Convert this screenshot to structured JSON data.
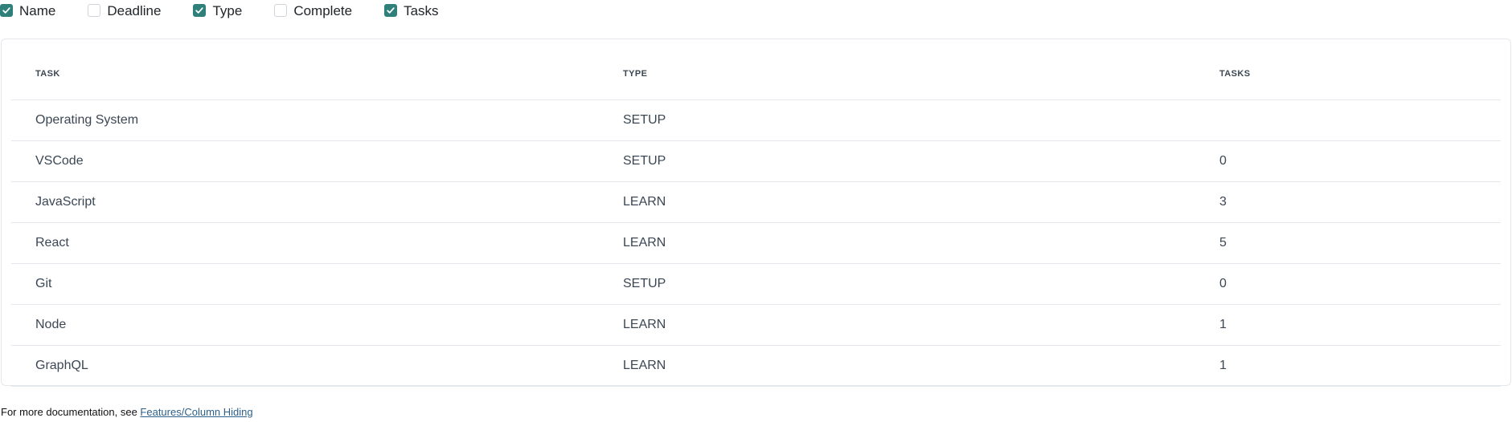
{
  "toggles": [
    {
      "label": "Name",
      "checked": true
    },
    {
      "label": "Deadline",
      "checked": false
    },
    {
      "label": "Type",
      "checked": true
    },
    {
      "label": "Complete",
      "checked": false
    },
    {
      "label": "Tasks",
      "checked": true
    }
  ],
  "table": {
    "headers": {
      "task": "TASK",
      "type": "TYPE",
      "tasks": "TASKS"
    },
    "rows": [
      {
        "task": "Operating System",
        "type": "SETUP",
        "tasks": ""
      },
      {
        "task": "VSCode",
        "type": "SETUP",
        "tasks": "0"
      },
      {
        "task": "JavaScript",
        "type": "LEARN",
        "tasks": "3"
      },
      {
        "task": "React",
        "type": "LEARN",
        "tasks": "5"
      },
      {
        "task": "Git",
        "type": "SETUP",
        "tasks": "0"
      },
      {
        "task": "Node",
        "type": "LEARN",
        "tasks": "1"
      },
      {
        "task": "GraphQL",
        "type": "LEARN",
        "tasks": "1"
      }
    ]
  },
  "footer": {
    "text": "For more documentation, see ",
    "link_label": "Features/Column Hiding"
  },
  "colors": {
    "accent": "#2f7f7b",
    "border": "#e4e7eb",
    "text_muted": "#3b4754",
    "link": "#2c5f8a"
  },
  "icons": {
    "checkbox_checked": "check-icon"
  }
}
